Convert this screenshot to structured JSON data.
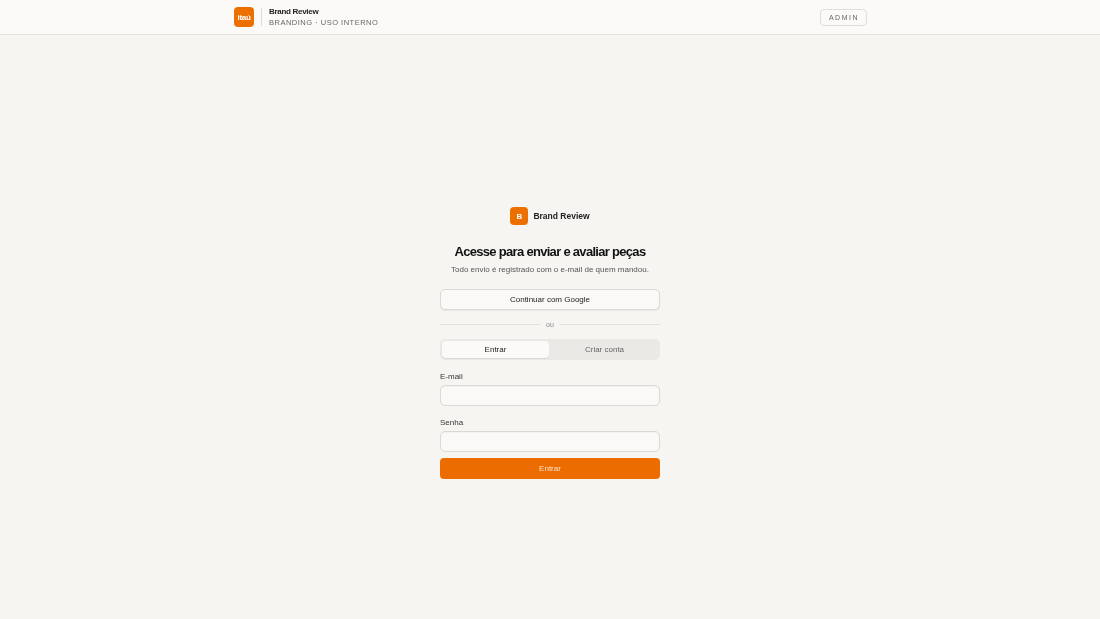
{
  "header": {
    "logo": "itaú",
    "title": "Brand Review",
    "subtitle": "BRANDING · USO INTERNO",
    "admin_button": "ADMIN"
  },
  "login": {
    "badge": "B",
    "app_name": "Brand Review",
    "heading": "Acesse para enviar e avaliar peças",
    "subtitle": "Todo envio é registrado com o e-mail de quem mandou.",
    "google_button": "Continuar com Google",
    "divider": "ou",
    "tabs": [
      {
        "label": "Entrar",
        "selected": true
      },
      {
        "label": "Criar conta",
        "selected": false
      }
    ],
    "fields": [
      {
        "label": "E-mail"
      },
      {
        "label": "Senha"
      }
    ],
    "submit": "Entrar"
  }
}
